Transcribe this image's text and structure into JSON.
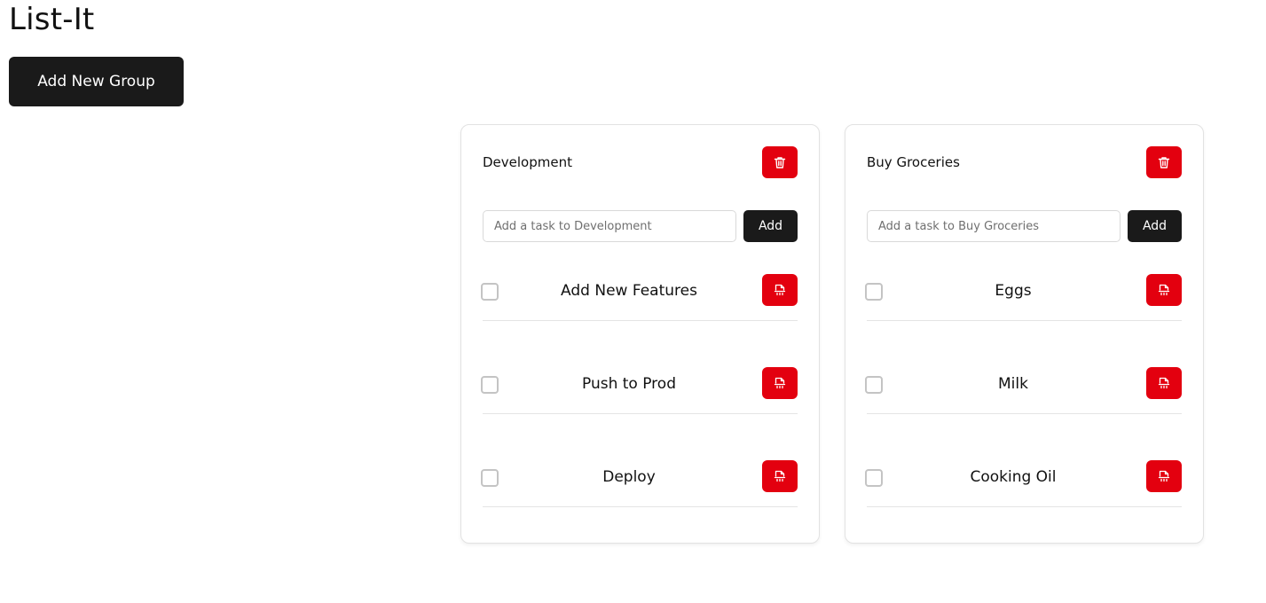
{
  "app": {
    "title": "List-It",
    "add_group_label": "Add New Group"
  },
  "colors": {
    "accent_red": "#e3000f",
    "dark": "#1a1a1a"
  },
  "groups": [
    {
      "name": "Development",
      "input_placeholder": "Add a task to Development",
      "add_label": "Add",
      "delete_icon": "trash-icon",
      "tasks": [
        {
          "label": "Add New Features",
          "checked": false,
          "delete_icon": "file-delete-icon"
        },
        {
          "label": "Push to Prod",
          "checked": false,
          "delete_icon": "file-delete-icon"
        },
        {
          "label": "Deploy",
          "checked": false,
          "delete_icon": "file-delete-icon"
        }
      ]
    },
    {
      "name": "Buy Groceries",
      "input_placeholder": "Add a task to Buy Groceries",
      "add_label": "Add",
      "delete_icon": "trash-icon",
      "tasks": [
        {
          "label": "Eggs",
          "checked": false,
          "delete_icon": "file-delete-icon"
        },
        {
          "label": "Milk",
          "checked": false,
          "delete_icon": "file-delete-icon"
        },
        {
          "label": "Cooking Oil",
          "checked": false,
          "delete_icon": "file-delete-icon"
        }
      ]
    }
  ]
}
